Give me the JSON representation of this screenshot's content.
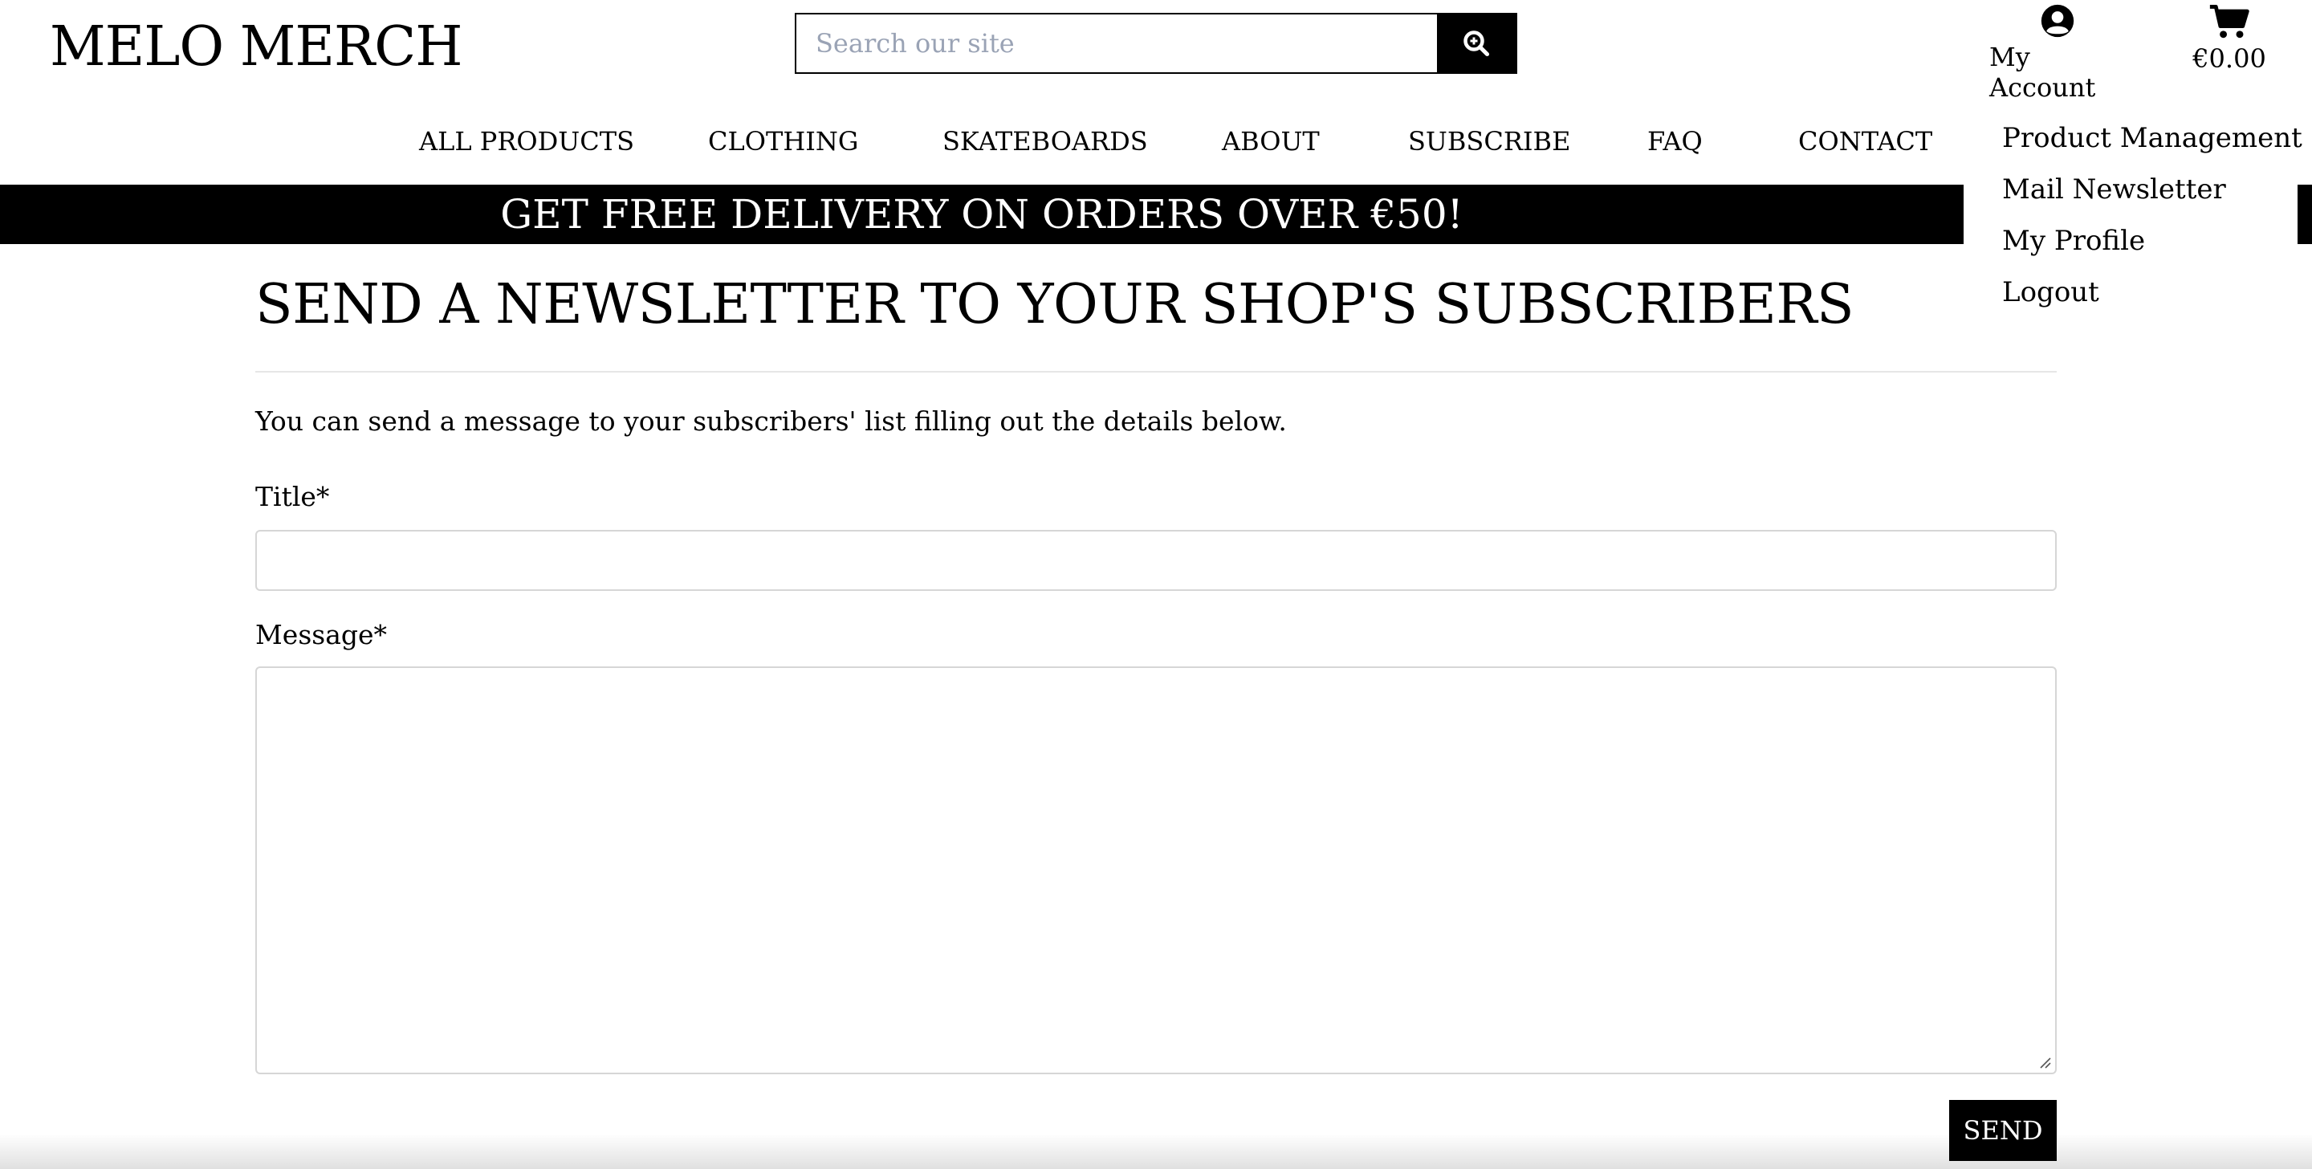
{
  "header": {
    "brand": "MELO MERCH",
    "search_placeholder": "Search our site",
    "search_icon": "search-zoom-icon",
    "account_label": "My Account",
    "account_icon": "user-circle-icon",
    "cart_total": "€0.00",
    "cart_icon": "shopping-cart-icon"
  },
  "nav": {
    "items": [
      "ALL PRODUCTS",
      "CLOTHING",
      "SKATEBOARDS",
      "ABOUT",
      "SUBSCRIBE",
      "FAQ",
      "CONTACT"
    ]
  },
  "account_menu": {
    "items": [
      "Product Management",
      "Mail Newsletter",
      "My Profile",
      "Logout"
    ]
  },
  "banner": {
    "text": "GET FREE DELIVERY ON ORDERS OVER €50!"
  },
  "page": {
    "heading": "SEND A NEWSLETTER TO YOUR SHOP'S SUBSCRIBERS",
    "intro": "You can send a message to your subscribers' list filling out the details below."
  },
  "form": {
    "title_label": "Title*",
    "title_value": "",
    "message_label": "Message*",
    "message_value": "",
    "submit_label": "SEND"
  },
  "colors": {
    "primary": "#000000",
    "background": "#ffffff",
    "placeholder": "#9aa3b5",
    "input_border": "#d6d6d6"
  }
}
